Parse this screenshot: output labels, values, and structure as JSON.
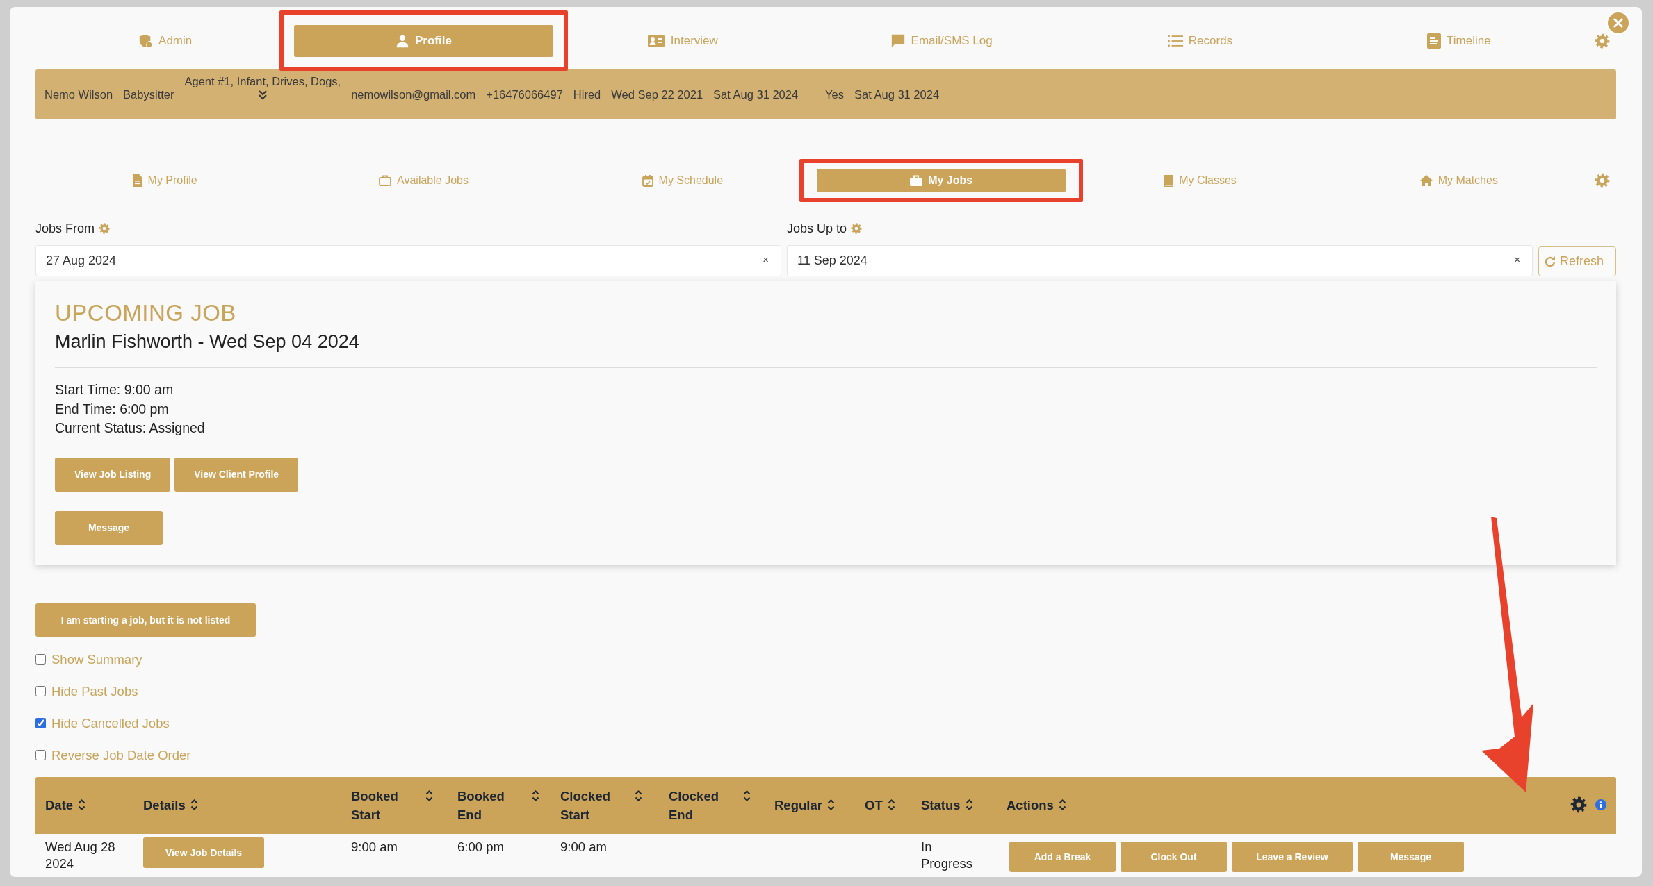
{
  "top_tabs": [
    {
      "label": "Admin",
      "selected": false,
      "highlighted": false
    },
    {
      "label": "Profile",
      "selected": true,
      "highlighted": true
    },
    {
      "label": "Interview",
      "selected": false,
      "highlighted": false
    },
    {
      "label": "Email/SMS Log",
      "selected": false,
      "highlighted": false
    },
    {
      "label": "Records",
      "selected": false,
      "highlighted": false
    },
    {
      "label": "Timeline",
      "selected": false,
      "highlighted": false
    }
  ],
  "profile_summary": [
    {
      "text": "Nemo Wilson",
      "expandable": false
    },
    {
      "text": "Babysitter",
      "expandable": false
    },
    {
      "text": "Agent #1, Infant, Drives, Dogs,",
      "expandable": true
    },
    {
      "text": "nemowilson@gmail.com",
      "expandable": false
    },
    {
      "text": "+16476066497",
      "expandable": false
    },
    {
      "text": "Hired",
      "expandable": false
    },
    {
      "text": "Wed Sep 22 2021",
      "expandable": false
    },
    {
      "text": "Sat Aug 31 2024",
      "expandable": false
    },
    {
      "text": "Yes",
      "expandable": false
    },
    {
      "text": "Sat Aug 31 2024",
      "expandable": false
    }
  ],
  "sub_tabs": [
    {
      "label": "My Profile",
      "selected": false,
      "highlighted": false
    },
    {
      "label": "Available Jobs",
      "selected": false,
      "highlighted": false
    },
    {
      "label": "My Schedule",
      "selected": false,
      "highlighted": false
    },
    {
      "label": "My Jobs",
      "selected": true,
      "highlighted": true
    },
    {
      "label": "My Classes",
      "selected": false,
      "highlighted": false
    },
    {
      "label": "My Matches",
      "selected": false,
      "highlighted": false
    }
  ],
  "date_filters": [
    {
      "label": "Jobs From",
      "value": "27 Aug 2024",
      "clear": "×"
    },
    {
      "label": "Jobs Up to",
      "value": "11 Sep 2024",
      "clear": "×"
    }
  ],
  "refresh_button": "Refresh",
  "upcoming_job": {
    "title": "UPCOMING JOB",
    "heading": "Marlin Fishworth - Wed Sep 04 2024",
    "details": [
      "Start Time: 9:00 am",
      "End Time: 6:00 pm",
      "Current Status: Assigned"
    ],
    "button_rows": [
      [
        "View Job Listing",
        "View Client Profile"
      ],
      [
        "Message"
      ]
    ]
  },
  "unlisted_job_button": "I am starting a job, but it is not listed",
  "options": [
    {
      "label": "Show Summary",
      "checked": false
    },
    {
      "label": "Hide Past Jobs",
      "checked": false
    },
    {
      "label": "Hide Cancelled Jobs",
      "checked": true
    },
    {
      "label": "Reverse Job Date Order",
      "checked": false
    }
  ],
  "jobs_table": {
    "columns": [
      "Date",
      "Details",
      "Booked Start",
      "Booked End",
      "Clocked Start",
      "Clocked End",
      "Regular",
      "OT",
      "Status",
      "Actions"
    ],
    "rows": [
      {
        "cells": [
          {
            "kind": "text",
            "text": "Wed Aug 28 2024"
          },
          {
            "kind": "button",
            "text": "View Job Details"
          },
          {
            "kind": "text",
            "text": "9:00 am"
          },
          {
            "kind": "text",
            "text": "6:00 pm"
          },
          {
            "kind": "text",
            "text": "9:00 am"
          },
          null,
          null,
          null,
          {
            "kind": "text",
            "text": "In Progress"
          },
          {
            "kind": "buttons",
            "buttons": [
              "Add a Break",
              "Clock Out",
              "Leave a Review",
              "Message"
            ]
          }
        ]
      }
    ]
  },
  "callout_arrow": true
}
